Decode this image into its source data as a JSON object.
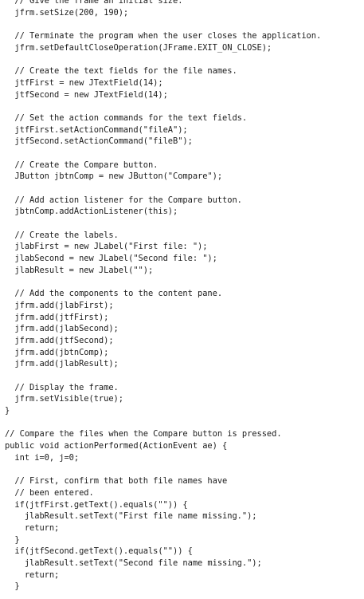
{
  "code": {
    "lines": [
      "  // Give the frame an initial size.",
      "  jfrm.setSize(200, 190);",
      "",
      "  // Terminate the program when the user closes the application.",
      "  jfrm.setDefaultCloseOperation(JFrame.EXIT_ON_CLOSE);",
      "",
      "  // Create the text fields for the file names.",
      "  jtfFirst = new JTextField(14);",
      "  jtfSecond = new JTextField(14);",
      "",
      "  // Set the action commands for the text fields.",
      "  jtfFirst.setActionCommand(\"fileA\");",
      "  jtfSecond.setActionCommand(\"fileB\");",
      "",
      "  // Create the Compare button.",
      "  JButton jbtnComp = new JButton(\"Compare\");",
      "",
      "  // Add action listener for the Compare button.",
      "  jbtnComp.addActionListener(this);",
      "",
      "  // Create the labels.",
      "  jlabFirst = new JLabel(\"First file: \");",
      "  jlabSecond = new JLabel(\"Second file: \");",
      "  jlabResult = new JLabel(\"\");",
      "",
      "  // Add the components to the content pane.",
      "  jfrm.add(jlabFirst);",
      "  jfrm.add(jtfFirst);",
      "  jfrm.add(jlabSecond);",
      "  jfrm.add(jtfSecond);",
      "  jfrm.add(jbtnComp);",
      "  jfrm.add(jlabResult);",
      "",
      "  // Display the frame.",
      "  jfrm.setVisible(true);",
      "}",
      "",
      "// Compare the files when the Compare button is pressed.",
      "public void actionPerformed(ActionEvent ae) {",
      "  int i=0, j=0;",
      "",
      "  // First, confirm that both file names have",
      "  // been entered.",
      "  if(jtfFirst.getText().equals(\"\")) {",
      "    jlabResult.setText(\"First file name missing.\");",
      "    return;",
      "  }",
      "  if(jtfSecond.getText().equals(\"\")) {",
      "    jlabResult.setText(\"Second file name missing.\");",
      "    return;",
      "  }"
    ]
  }
}
